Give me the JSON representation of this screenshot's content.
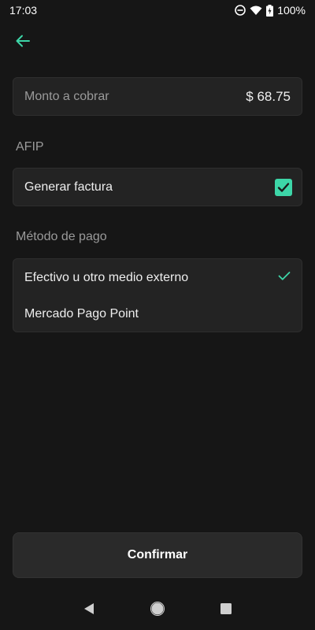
{
  "status_bar": {
    "time": "17:03",
    "battery": "100%",
    "icons": [
      "do-not-disturb-icon",
      "wifi-icon",
      "battery-charging-icon"
    ]
  },
  "header": {
    "back_icon": "arrow-left-icon"
  },
  "amount": {
    "label": "Monto a cobrar",
    "value": "$ 68.75"
  },
  "afip": {
    "section_label": "AFIP",
    "invoice_label": "Generar factura",
    "invoice_checked": true
  },
  "payment": {
    "section_label": "Método de pago",
    "options": [
      {
        "label": "Efectivo u otro medio externo",
        "selected": true
      },
      {
        "label": "Mercado Pago Point",
        "selected": false
      }
    ]
  },
  "footer": {
    "confirm_label": "Confirmar"
  },
  "colors": {
    "accent": "#3dd6a8",
    "background": "#161616",
    "card": "#232323"
  },
  "nav": {
    "icons": [
      "back-triangle-icon",
      "home-circle-icon",
      "recents-square-icon"
    ]
  }
}
